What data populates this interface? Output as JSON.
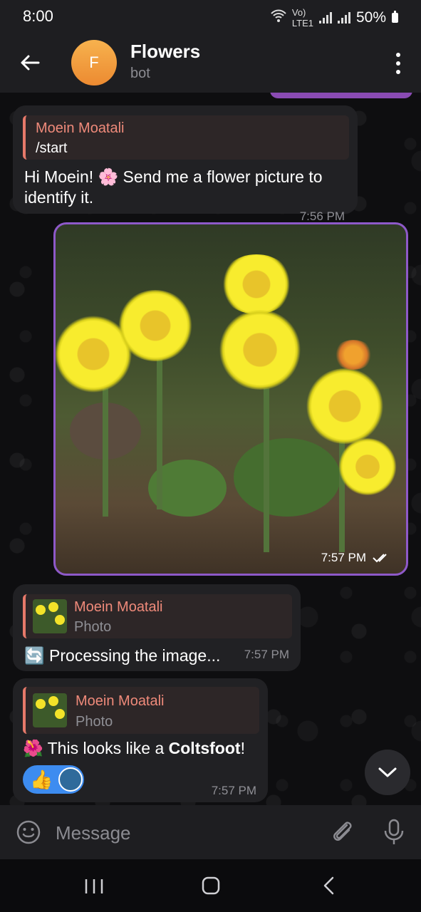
{
  "status": {
    "time": "8:00",
    "network_top": "Vo)",
    "network_bottom": "LTE1",
    "battery": "50%"
  },
  "header": {
    "avatar_letter": "F",
    "title": "Flowers",
    "subtitle": "bot"
  },
  "messages": [
    {
      "reply_name": "Moein Moatali",
      "reply_text": "/start",
      "text": "Hi Moein! 🌸 Send me a flower picture to identify it.",
      "time": "7:56 PM"
    },
    {
      "photo_time": "7:57 PM"
    },
    {
      "reply_name": "Moein Moatali",
      "reply_text": "Photo",
      "text_prefix": "🔄",
      "text": "Processing the image...",
      "time": "7:57 PM"
    },
    {
      "reply_name": "Moein Moatali",
      "reply_text": "Photo",
      "text_prefix": "🌺",
      "text_before": "This looks like a ",
      "text_bold": "Coltsfoot",
      "text_after": "!",
      "reaction": "👍",
      "time": "7:57 PM"
    }
  ],
  "input": {
    "placeholder": "Message"
  },
  "icons": {
    "back": "arrow-left-icon",
    "menu": "more-vertical-icon",
    "scroll": "chevron-down-icon",
    "emoji": "smile-icon",
    "attach": "paperclip-icon",
    "mic": "microphone-icon"
  },
  "colors": {
    "accent": "#8e59c9",
    "reply": "#ef8a7a",
    "avatar": "#f1a03f",
    "reaction": "#3d8cf0"
  }
}
